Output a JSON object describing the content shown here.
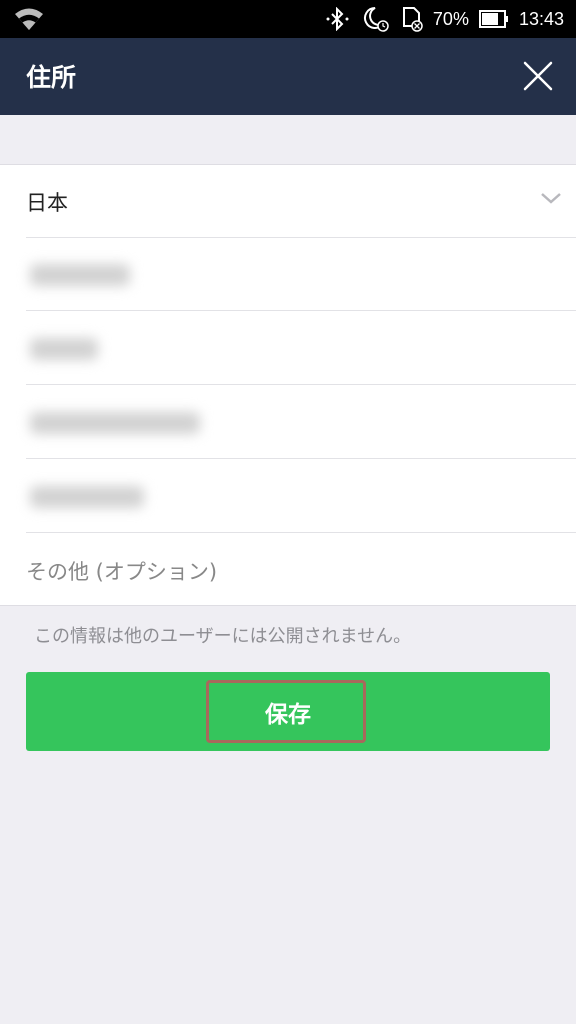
{
  "status_bar": {
    "battery": "70%",
    "time": "13:43",
    "icons": [
      "wifi-icon",
      "bluetooth-icon",
      "night-mode-alarm-icon",
      "sim-card-icon",
      "battery-icon"
    ]
  },
  "header": {
    "title": "住所",
    "close_icon": "close-icon"
  },
  "form": {
    "country": "日本",
    "postal_code": "",
    "prefecture": "",
    "city": "",
    "street": "",
    "other_placeholder": "その他 (オプション)"
  },
  "notice": "この情報は他のユーザーには公開されません。",
  "save_button": {
    "label": "保存"
  },
  "colors": {
    "header_bg": "#243049",
    "accent": "#35c55c",
    "page_bg": "#efeef3",
    "highlight_border": "#a9685c"
  }
}
